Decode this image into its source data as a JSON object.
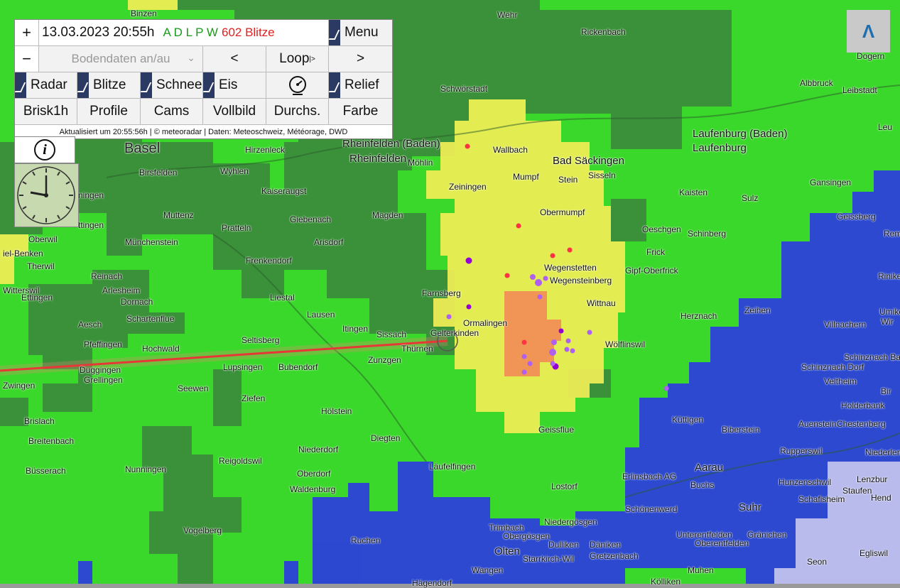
{
  "toolbar": {
    "zoom_in": "+",
    "zoom_out": "−",
    "datetime": "13.03.2023 20:55h",
    "layers_code": "A D L P W",
    "lightning_count": "602 Blitze",
    "menu_label": "Menu",
    "ground_select": "Bodendaten an/au",
    "prev": "<",
    "loop": "Loop",
    "loop_suffix": "|>",
    "next": ">",
    "radar": "Radar",
    "lightning": "Blitze",
    "snow": "Schnee",
    "ice": "Eis",
    "relief": "Relief",
    "brisk": "Brisk1h",
    "profile": "Profile",
    "cams": "Cams",
    "fullscreen": "Vollbild",
    "transparency": "Durchs.",
    "color": "Farbe",
    "status": "Aktualisiert um 20:55:56h | © meteoradar | Daten: Meteoschweiz, Météorage, DWD",
    "info_symbol": "i",
    "up_symbol": "Λ"
  },
  "colors": {
    "green": "#33dd22",
    "darkgreen": "#3b8a3b",
    "yellow": "#f0ee55",
    "orange": "#f09055",
    "blue": "#2b3ddd",
    "lightblue": "#b8b8e6",
    "lightning_red": "#ff3344",
    "lightning_purple": "#b060f0",
    "track_red": "#e02020"
  },
  "map": {
    "places": [
      {
        "name": "Basel"
      },
      {
        "name": "Rheinfelden (Baden)"
      },
      {
        "name": "Rheinfelden"
      },
      {
        "name": "Bad Säckingen"
      },
      {
        "name": "Laufenburg (Baden)"
      },
      {
        "name": "Laufenburg"
      },
      {
        "name": "Binzen"
      },
      {
        "name": "Wehr"
      },
      {
        "name": "Rickenbach"
      },
      {
        "name": "Schwörstadt"
      },
      {
        "name": "Albbruck"
      },
      {
        "name": "Leibstadt"
      },
      {
        "name": "Dogern"
      },
      {
        "name": "Birsfelden"
      },
      {
        "name": "Wyhlen"
      },
      {
        "name": "Kaiseraugst"
      },
      {
        "name": "Hirzenleck"
      },
      {
        "name": "Muttenz"
      },
      {
        "name": "Pratteln"
      },
      {
        "name": "Münchenstein"
      },
      {
        "name": "Oberwil"
      },
      {
        "name": "Therwil"
      },
      {
        "name": "Reinach"
      },
      {
        "name": "Arlesheim"
      },
      {
        "name": "Dornach"
      },
      {
        "name": "Ettingen"
      },
      {
        "name": "Witterswil"
      },
      {
        "name": "Aesch"
      },
      {
        "name": "Schartenflue"
      },
      {
        "name": "Pfeffingen"
      },
      {
        "name": "Hochwald"
      },
      {
        "name": "Duggingen"
      },
      {
        "name": "Grellingen"
      },
      {
        "name": "Zwingen"
      },
      {
        "name": "Brislach"
      },
      {
        "name": "Breitenbach"
      },
      {
        "name": "Büsserach"
      },
      {
        "name": "Nunningen"
      },
      {
        "name": "Vogelberg"
      },
      {
        "name": "Reigoldswil"
      },
      {
        "name": "Seewen"
      },
      {
        "name": "Ziefen"
      },
      {
        "name": "Lupsingen"
      },
      {
        "name": "Bubendorf"
      },
      {
        "name": "Seltisberg"
      },
      {
        "name": "Liestal"
      },
      {
        "name": "Lausen"
      },
      {
        "name": "Itingen"
      },
      {
        "name": "Sissach"
      },
      {
        "name": "Thürnen"
      },
      {
        "name": "Zunzgen"
      },
      {
        "name": "Gelterkinden"
      },
      {
        "name": "Ormalingen"
      },
      {
        "name": "Farnsberg"
      },
      {
        "name": "Hölstein"
      },
      {
        "name": "Diegten"
      },
      {
        "name": "Niederdorf"
      },
      {
        "name": "Oberdorf"
      },
      {
        "name": "Waldenburg"
      },
      {
        "name": "Läufelfingen"
      },
      {
        "name": "Frenkendorf"
      },
      {
        "name": "Arisdorf"
      },
      {
        "name": "Giebenach"
      },
      {
        "name": "Magden"
      },
      {
        "name": "Möhlin"
      },
      {
        "name": "Wallbach"
      },
      {
        "name": "Zeiningen"
      },
      {
        "name": "Mumpf"
      },
      {
        "name": "Stein"
      },
      {
        "name": "Sisseln"
      },
      {
        "name": "Obermumpf"
      },
      {
        "name": "Wegenstetten"
      },
      {
        "name": "Wegensteinberg"
      },
      {
        "name": "Wittnau"
      },
      {
        "name": "Wölflinswil"
      },
      {
        "name": "Kaisten"
      },
      {
        "name": "Sulz"
      },
      {
        "name": "Gansingen"
      },
      {
        "name": "Geissberg"
      },
      {
        "name": "Oeschgen"
      },
      {
        "name": "Schinberg"
      },
      {
        "name": "Frick"
      },
      {
        "name": "Gipf-Oberfrick"
      },
      {
        "name": "Herznach"
      },
      {
        "name": "Zeihen"
      },
      {
        "name": "Villnachern"
      },
      {
        "name": "Umiker"
      },
      {
        "name": "Riniken"
      },
      {
        "name": "Remig"
      },
      {
        "name": "Schinznach Dorf"
      },
      {
        "name": "Schinznach Ba"
      },
      {
        "name": "Veltheim"
      },
      {
        "name": "Holderbank"
      },
      {
        "name": "Auenstein"
      },
      {
        "name": "Chestenberg"
      },
      {
        "name": "Biberstein"
      },
      {
        "name": "Küttigen"
      },
      {
        "name": "Geissflue"
      },
      {
        "name": "Rupperswil"
      },
      {
        "name": "Niederlenz"
      },
      {
        "name": "Lenzbur"
      },
      {
        "name": "Staufen"
      },
      {
        "name": "Hunzenschwil"
      },
      {
        "name": "Schafisheim"
      },
      {
        "name": "Aarau"
      },
      {
        "name": "Buchs"
      },
      {
        "name": "Suhr"
      },
      {
        "name": "Erlinsbach AG"
      },
      {
        "name": "Lostorf"
      },
      {
        "name": "Schönenwerd"
      },
      {
        "name": "Niedergösgen"
      },
      {
        "name": "Obergösgen"
      },
      {
        "name": "Dulliken"
      },
      {
        "name": "Däniken"
      },
      {
        "name": "Gretzenbach"
      },
      {
        "name": "Unterentfelden"
      },
      {
        "name": "Oberentfelden"
      },
      {
        "name": "Gränichen"
      },
      {
        "name": "Olten"
      },
      {
        "name": "Starrkirch-Wil"
      },
      {
        "name": "Trimbach"
      },
      {
        "name": "Wangen"
      },
      {
        "name": "Hägendorf"
      },
      {
        "name": "Ruchen"
      },
      {
        "name": "Kölliken"
      },
      {
        "name": "Muhen"
      },
      {
        "name": "Seon"
      },
      {
        "name": "Egliswil"
      },
      {
        "name": "Hend"
      },
      {
        "name": "Leu"
      },
      {
        "name": "Bir"
      },
      {
        "name": "Wir"
      },
      {
        "name": "ningen"
      },
      {
        "name": "ttingen"
      },
      {
        "name": "iel-Benken"
      }
    ]
  }
}
